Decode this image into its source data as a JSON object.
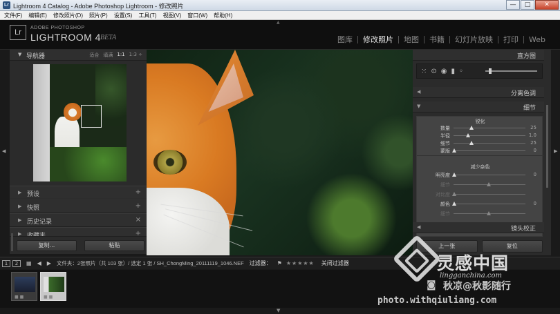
{
  "window": {
    "app_icon": "Lr",
    "title": "Lightroom 4 Catalog - Adobe Photoshop Lightroom - 修改照片",
    "controls": [
      "—",
      "□",
      "✕"
    ]
  },
  "menubar": {
    "items": [
      "文件(F)",
      "编辑(E)",
      "修改照片(D)",
      "照片(P)",
      "设置(S)",
      "工具(T)",
      "视图(V)",
      "窗口(W)",
      "帮助(H)"
    ]
  },
  "identity": {
    "badge": "Lr",
    "company": "ADOBE PHOTOSHOP",
    "product": "LIGHTROOM 4",
    "beta": "BETA"
  },
  "modules": {
    "items": [
      "图库",
      "修改照片",
      "地图",
      "书籍",
      "幻灯片放映",
      "打印",
      "Web"
    ],
    "active_index": 1
  },
  "navigator": {
    "title": "导航器",
    "zoom_options": [
      "适合",
      "填满",
      "1:1",
      "1:3 ÷"
    ],
    "active_zoom": "1:1"
  },
  "left_panels": [
    {
      "label": "预设",
      "action": "+"
    },
    {
      "label": "快照",
      "action": "+"
    },
    {
      "label": "历史记录",
      "action": "×"
    },
    {
      "label": "收藏夹",
      "action": "+"
    }
  ],
  "left_buttons": {
    "copy": "复制...",
    "paste": "粘贴"
  },
  "right_panel": {
    "histogram_title": "直方图",
    "split_toning": "分离色调",
    "detail_title": "细节",
    "lens_title": "镜头校正",
    "sharpening_title": "锐化",
    "noise_title": "减少杂色",
    "sharpening": [
      {
        "label": "数量",
        "value": "25",
        "pos": 0.25
      },
      {
        "label": "半径",
        "value": "1.0",
        "pos": 0.2
      },
      {
        "label": "细节",
        "value": "25",
        "pos": 0.25
      },
      {
        "label": "蒙版",
        "value": "0",
        "pos": 0.0
      }
    ],
    "noise": [
      {
        "label": "明亮度",
        "value": "0",
        "pos": 0.0,
        "dim": false
      },
      {
        "label": "细节",
        "value": "",
        "pos": 0.5,
        "dim": true
      },
      {
        "label": "对比度",
        "value": "",
        "pos": 0.0,
        "dim": true
      },
      {
        "label": "颜色",
        "value": "0",
        "pos": 0.0,
        "dim": false
      },
      {
        "label": "细节",
        "value": "",
        "pos": 0.5,
        "dim": true
      }
    ],
    "bottom_buttons": {
      "previous": "上一张",
      "reset": "复位"
    }
  },
  "filmstrip_toolbar": {
    "page1": "1",
    "page2": "2",
    "breadcrumb": "文件夹：2张照片（共 103 张）/ 选定 1 张 / SH_ChongMing_20111119_1046.NEF",
    "filter_label": "过滤器：",
    "stars": "★★★★★",
    "filter_off": "关闭过滤器"
  },
  "filmstrip": {
    "thumbs": [
      {
        "dots": "■ ■",
        "selected": false
      },
      {
        "dots": "■ ■",
        "selected": true
      }
    ]
  },
  "watermark": {
    "brand": "灵感中国",
    "domain": "lingganchina.com",
    "credit": "秋凉@秋影随行",
    "site": "photo.withqiuliang.com"
  }
}
